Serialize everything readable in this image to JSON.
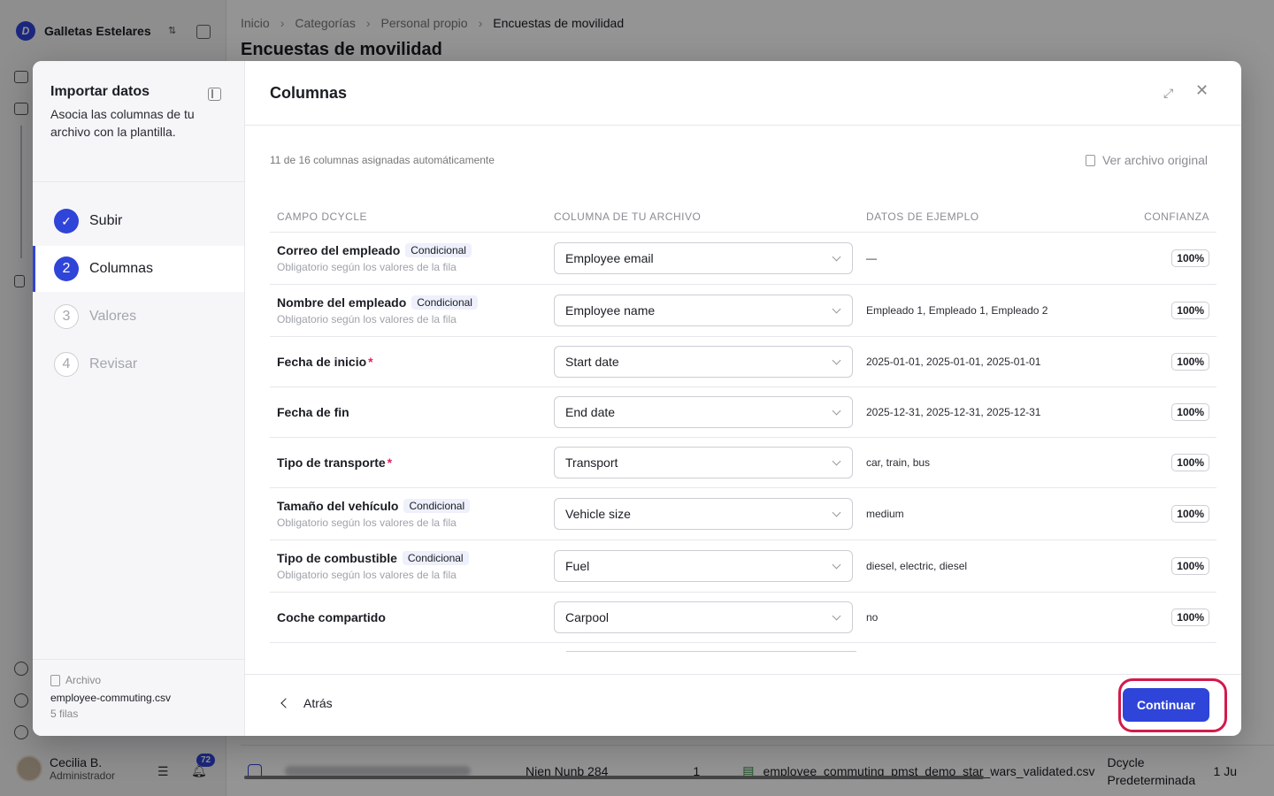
{
  "sidebar": {
    "org_name": "Galletas Estelares",
    "user_name": "Cecilia B.",
    "user_role": "Administrador",
    "notifications_count": "72"
  },
  "main": {
    "breadcrumb": [
      "Inicio",
      "Categorías",
      "Personal propio",
      "Encuestas de movilidad"
    ],
    "page_title": "Encuestas de movilidad",
    "bg_row": {
      "owner": "Nien Nunb 284",
      "count": "1",
      "file": "employee_commuting_pmst_demo_star_wars_validated.csv",
      "type": "Dcycle Predeterminada",
      "date_fragment": "1 Ju"
    }
  },
  "modal": {
    "panel": {
      "title": "Importar datos",
      "description": "Asocia las columnas de tu archivo con la plantilla.",
      "steps": [
        {
          "num": "✓",
          "label": "Subir",
          "state": "done"
        },
        {
          "num": "2",
          "label": "Columnas",
          "state": "active"
        },
        {
          "num": "3",
          "label": "Valores",
          "state": "todo"
        },
        {
          "num": "4",
          "label": "Revisar",
          "state": "todo"
        }
      ],
      "file_label": "Archivo",
      "file_name": "employee-commuting.csv",
      "file_rows": "5 filas"
    },
    "title": "Columnas",
    "auto_mapped": "11 de 16 columnas asignadas automáticamente",
    "view_original": "Ver archivo original",
    "headers": [
      "CAMPO DCYCLE",
      "COLUMNA DE TU ARCHIVO",
      "DATOS DE EJEMPLO",
      "CONFIANZA"
    ],
    "rows": [
      {
        "field": "Correo del empleado",
        "badge": "Condicional",
        "sub": "Obligatorio según los valores de la fila",
        "column": "Employee email",
        "sample": "—",
        "confidence": "100%"
      },
      {
        "field": "Nombre del empleado",
        "badge": "Condicional",
        "sub": "Obligatorio según los valores de la fila",
        "column": "Employee name",
        "sample": "Empleado 1, Empleado 1, Empleado 2",
        "confidence": "100%"
      },
      {
        "field": "Fecha de inicio",
        "required": "*",
        "column": "Start date",
        "sample": "2025-01-01, 2025-01-01, 2025-01-01",
        "confidence": "100%"
      },
      {
        "field": "Fecha de fin",
        "column": "End date",
        "sample": "2025-12-31, 2025-12-31, 2025-12-31",
        "confidence": "100%"
      },
      {
        "field": "Tipo de transporte",
        "required": "*",
        "column": "Transport",
        "sample": "car, train, bus",
        "confidence": "100%"
      },
      {
        "field": "Tamaño del vehículo",
        "badge": "Condicional",
        "sub": "Obligatorio según los valores de la fila",
        "column": "Vehicle size",
        "sample": "medium",
        "confidence": "100%"
      },
      {
        "field": "Tipo de combustible",
        "badge": "Condicional",
        "sub": "Obligatorio según los valores de la fila",
        "column": "Fuel",
        "sample": "diesel, electric, diesel",
        "confidence": "100%"
      },
      {
        "field": "Coche compartido",
        "column": "Carpool",
        "sample": "no",
        "confidence": "100%"
      }
    ],
    "back_label": "Atrás",
    "continue_label": "Continuar"
  },
  "colors": {
    "accent": "#2f44d8",
    "required": "#e0245e",
    "highlight": "#d31a4b"
  }
}
